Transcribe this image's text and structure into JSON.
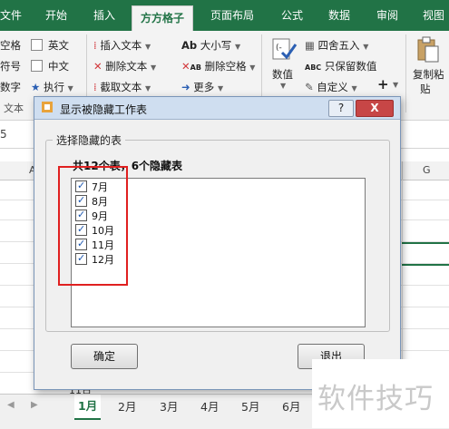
{
  "ribbon_tabs": {
    "file": "文件",
    "home": "开始",
    "insert": "插入",
    "active": "方方格子",
    "page_layout": "页面布局",
    "formulas": "公式",
    "data": "数据",
    "review": "审阅",
    "view": "视图"
  },
  "ribbon": {
    "space": "空格",
    "english": "英文",
    "symbol": "符号",
    "chinese": "中文",
    "number": "数字",
    "execute": "执行",
    "group_text": "文本",
    "insert_text": "插入文本",
    "delete_text": "删除文本",
    "extract_text": "截取文本",
    "upper_lower": "大小写",
    "delete_space": "删除空格",
    "more": "更多",
    "value": "数值",
    "round": "四舍五入",
    "keep_value": "只保留数值",
    "custom": "自定义",
    "copy_paste_1": "复制粘",
    "copy_paste_2": "贴",
    "ab_glyph": "Ab",
    "abc_glyph": "ABC"
  },
  "sheet": {
    "cell_ref": "5",
    "col_a": "A",
    "col_g": "G",
    "row_label": "11日",
    "tabs": [
      "1月",
      "2月",
      "3月",
      "4月",
      "5月",
      "6月"
    ]
  },
  "dialog": {
    "title": "显示被隐藏工作表",
    "help": "?",
    "close": "X",
    "legend": "选择隐藏的表",
    "count_label": "共12个表，6个隐藏表",
    "items": [
      "7月",
      "8月",
      "9月",
      "10月",
      "11月",
      "12月"
    ],
    "ok": "确定",
    "exit": "退出"
  },
  "watermark": "软件技巧",
  "colors": {
    "accent": "#217346",
    "highlight": "#e02020"
  }
}
